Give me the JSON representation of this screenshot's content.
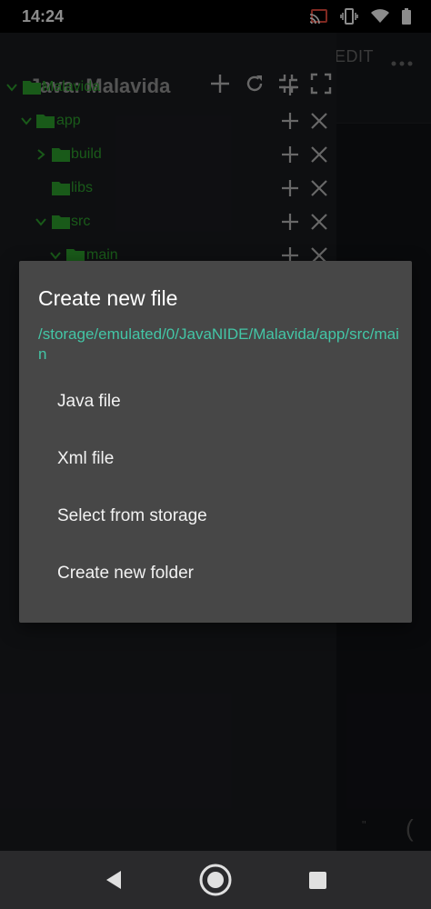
{
  "status": {
    "time": "14:24",
    "icons": [
      "cast-icon",
      "vibrate-icon",
      "wifi-icon",
      "battery-icon"
    ]
  },
  "drawer": {
    "title": "Java: Malavida",
    "header_icons": [
      "add-icon",
      "refresh-icon",
      "collapse-icon",
      "fullscreen-icon"
    ],
    "tree": [
      {
        "label": "Malavida",
        "depth": 0,
        "expanded": true
      },
      {
        "label": "app",
        "depth": 1,
        "expanded": true
      },
      {
        "label": "build",
        "depth": 2,
        "expanded": false
      },
      {
        "label": "libs",
        "depth": 2,
        "expanded": null
      },
      {
        "label": "src",
        "depth": 2,
        "expanded": true
      },
      {
        "label": "main",
        "depth": 3,
        "expanded": true
      }
    ]
  },
  "editor": {
    "edit_label": "EDIT",
    "quote": "\"",
    "paren": "("
  },
  "dialog": {
    "title": "Create new file",
    "path": "/storage/emulated/0/JavaNIDE/Malavida/app/src/main",
    "items": [
      "Java file",
      "Xml file",
      "Select from storage",
      "Create new folder"
    ]
  },
  "colors": {
    "folder": "#2fa52f",
    "path": "#43c6a6",
    "dialog_bg": "#474747"
  }
}
